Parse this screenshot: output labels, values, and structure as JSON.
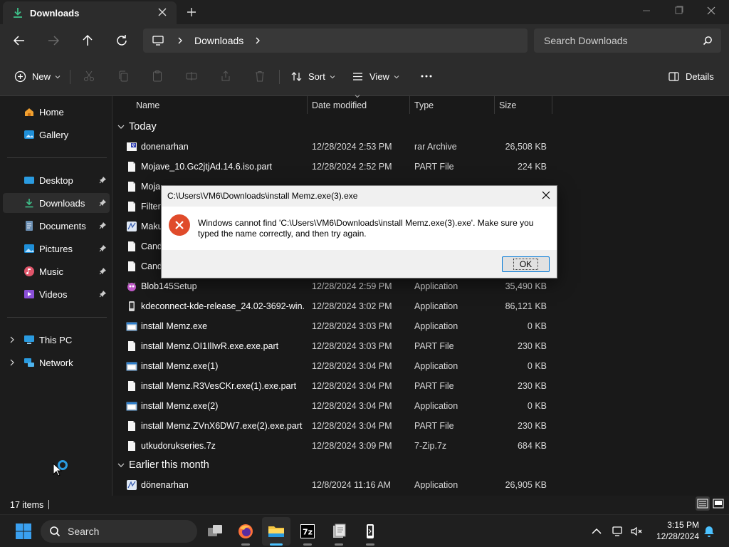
{
  "window": {
    "tab_title": "Downloads",
    "breadcrumb": [
      "Downloads"
    ],
    "search_placeholder": "Search Downloads"
  },
  "commandbar": {
    "new_label": "New",
    "sort_label": "Sort",
    "view_label": "View",
    "details_label": "Details"
  },
  "sidebar": {
    "items": [
      {
        "label": "Home",
        "icon": "home-icon"
      },
      {
        "label": "Gallery",
        "icon": "gallery-icon"
      },
      {
        "label": "Desktop",
        "icon": "desktop-icon",
        "pinned": true
      },
      {
        "label": "Downloads",
        "icon": "download-icon",
        "pinned": true,
        "selected": true
      },
      {
        "label": "Documents",
        "icon": "documents-icon",
        "pinned": true
      },
      {
        "label": "Pictures",
        "icon": "pictures-icon",
        "pinned": true
      },
      {
        "label": "Music",
        "icon": "music-icon",
        "pinned": true
      },
      {
        "label": "Videos",
        "icon": "videos-icon",
        "pinned": true
      },
      {
        "label": "This PC",
        "icon": "pc-icon"
      },
      {
        "label": "Network",
        "icon": "network-icon"
      }
    ]
  },
  "columns": {
    "name": "Name",
    "date": "Date modified",
    "type": "Type",
    "size": "Size"
  },
  "groups": {
    "today": "Today",
    "earlier": "Earlier this month"
  },
  "files": [
    {
      "name": "donenarhan",
      "date": "12/28/2024 2:53 PM",
      "type": "rar Archive",
      "size": "26,508 KB",
      "icon": "rar-icon"
    },
    {
      "name": "Mojave_10.Gc2jtjAd.14.6.iso.part",
      "date": "12/28/2024 2:52 PM",
      "type": "PART File",
      "size": "224 KB",
      "icon": "file-icon"
    },
    {
      "name": "Moja",
      "date": "",
      "type": "",
      "size": "",
      "icon": "file-icon"
    },
    {
      "name": "Filter",
      "date": "",
      "type": "",
      "size": "",
      "icon": "file-icon"
    },
    {
      "name": "Maku",
      "date": "",
      "type": "",
      "size": "",
      "icon": "app-icon"
    },
    {
      "name": "Cand",
      "date": "",
      "type": "",
      "size": "",
      "icon": "file-icon"
    },
    {
      "name": "Cand",
      "date": "",
      "type": "",
      "size": "",
      "icon": "file-icon"
    },
    {
      "name": "Blob145Setup",
      "date": "12/28/2024 2:59 PM",
      "type": "Application",
      "size": "35,490 KB",
      "icon": "setup-icon"
    },
    {
      "name": "kdeconnect-kde-release_24.02-3692-win...",
      "date": "12/28/2024 3:02 PM",
      "type": "Application",
      "size": "86,121 KB",
      "icon": "kde-icon"
    },
    {
      "name": "install Memz.exe",
      "date": "12/28/2024 3:03 PM",
      "type": "Application",
      "size": "0 KB",
      "icon": "exe-icon"
    },
    {
      "name": "install Memz.OI1IlIwR.exe.exe.part",
      "date": "12/28/2024 3:03 PM",
      "type": "PART File",
      "size": "230 KB",
      "icon": "file-icon"
    },
    {
      "name": "install Memz.exe(1)",
      "date": "12/28/2024 3:04 PM",
      "type": "Application",
      "size": "0 KB",
      "icon": "exe-icon"
    },
    {
      "name": "install Memz.R3VesCKr.exe(1).exe.part",
      "date": "12/28/2024 3:04 PM",
      "type": "PART File",
      "size": "230 KB",
      "icon": "file-icon"
    },
    {
      "name": "install Memz.exe(2)",
      "date": "12/28/2024 3:04 PM",
      "type": "Application",
      "size": "0 KB",
      "icon": "exe-icon"
    },
    {
      "name": "install Memz.ZVnX6DW7.exe(2).exe.part",
      "date": "12/28/2024 3:04 PM",
      "type": "PART File",
      "size": "230 KB",
      "icon": "file-icon"
    },
    {
      "name": "utkudorukseries.7z",
      "date": "12/28/2024 3:09 PM",
      "type": "7-Zip.7z",
      "size": "684 KB",
      "icon": "file-icon"
    }
  ],
  "earlier_files": [
    {
      "name": "dönenarhan",
      "date": "12/8/2024 11:16 AM",
      "type": "Application",
      "size": "26,905 KB",
      "icon": "app-icon"
    }
  ],
  "status": {
    "item_count": "17 items"
  },
  "dialog": {
    "title": "C:\\Users\\VM6\\Downloads\\install Memz.exe(3).exe",
    "message": "Windows cannot find 'C:\\Users\\VM6\\Downloads\\install Memz.exe(3).exe'. Make sure you typed the name correctly, and then try again.",
    "ok_label": "OK"
  },
  "taskbar": {
    "search_label": "Search",
    "time": "3:15 PM",
    "date": "12/28/2024"
  },
  "colors": {
    "accent": "#4cc2ff",
    "error": "#e04b2b",
    "background": "#191919"
  }
}
